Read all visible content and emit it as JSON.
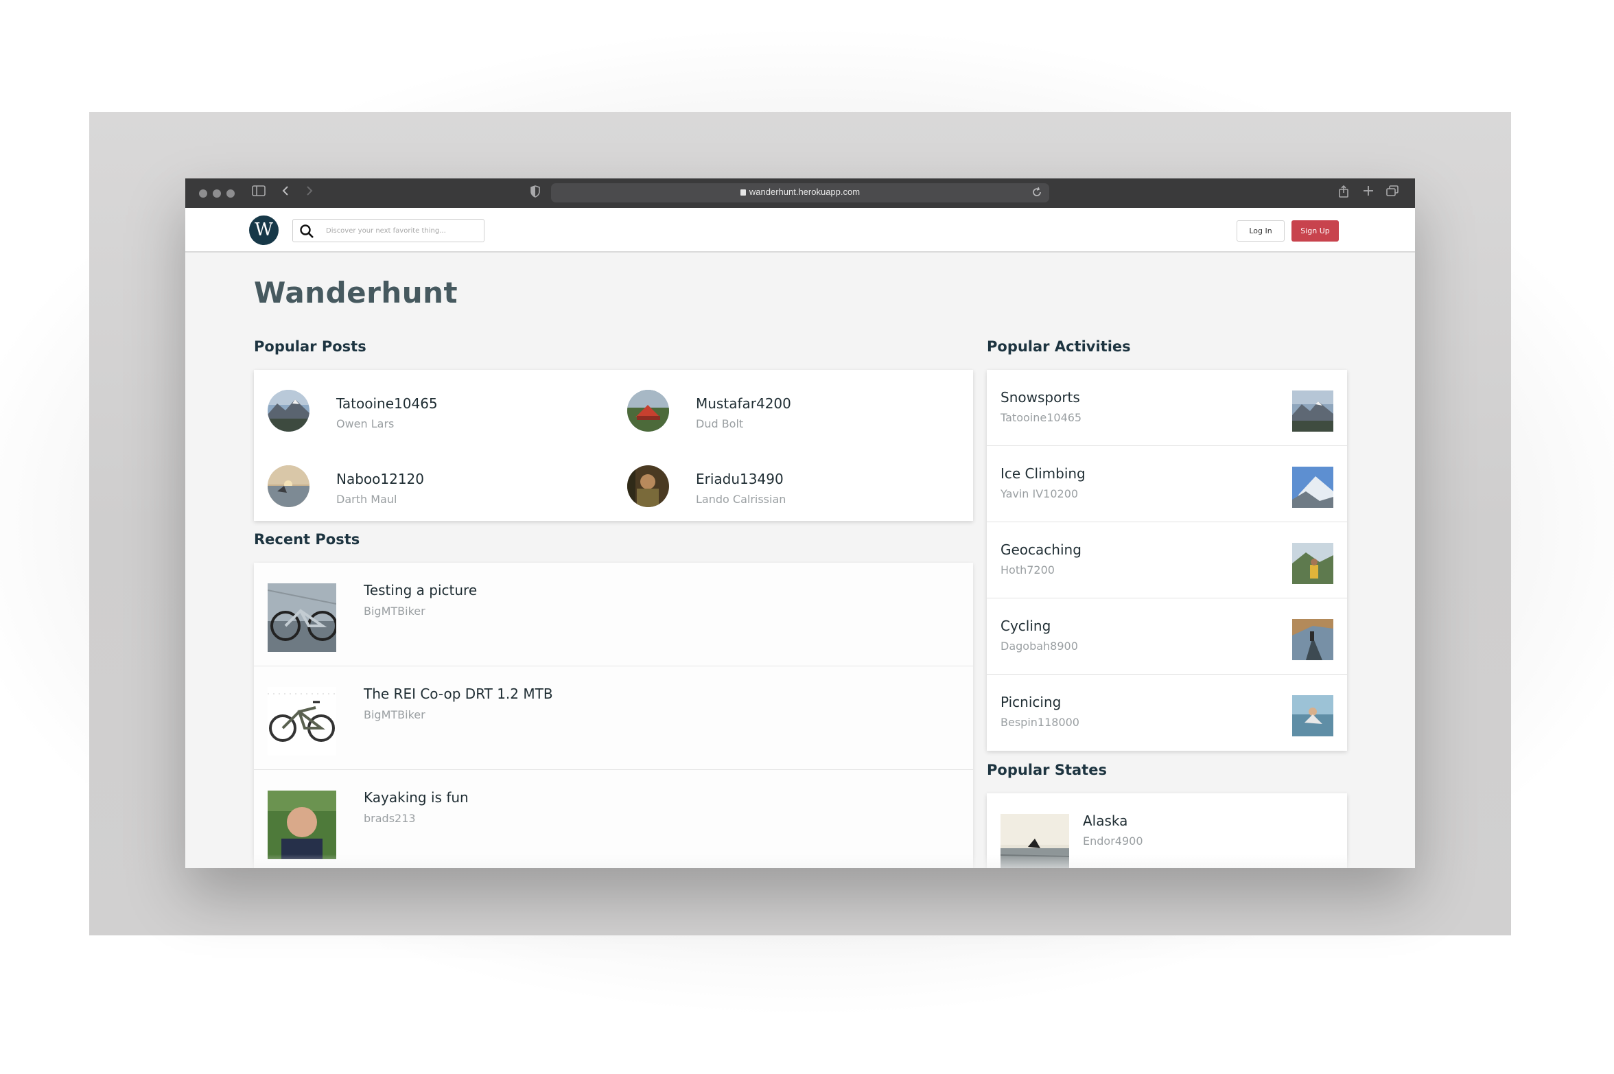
{
  "browser": {
    "url": "wanderhunt.herokuapp.com"
  },
  "navbar": {
    "logo_letter": "W",
    "search_placeholder": "Discover your next favorite thing...",
    "login_label": "Log In",
    "signup_label": "Sign Up",
    "signup_color": "#c8434d",
    "logo_color": "#173848"
  },
  "page": {
    "title": "Wanderhunt"
  },
  "popular_posts": {
    "heading": "Popular Posts",
    "items": [
      {
        "title": "Tatooine10465",
        "author": "Owen Lars"
      },
      {
        "title": "Mustafar4200",
        "author": "Dud Bolt"
      },
      {
        "title": "Naboo12120",
        "author": "Darth Maul"
      },
      {
        "title": "Eriadu13490",
        "author": "Lando Calrissian"
      }
    ]
  },
  "recent_posts": {
    "heading": "Recent Posts",
    "items": [
      {
        "title": "Testing a picture",
        "author": "BigMTBiker"
      },
      {
        "title": "The REI Co-op DRT 1.2 MTB",
        "author": "BigMTBiker"
      },
      {
        "title": "Kayaking is fun",
        "author": "brads213"
      }
    ]
  },
  "popular_activities": {
    "heading": "Popular Activities",
    "items": [
      {
        "title": "Snowsports",
        "location": "Tatooine10465"
      },
      {
        "title": "Ice Climbing",
        "location": "Yavin IV10200"
      },
      {
        "title": "Geocaching",
        "location": "Hoth7200"
      },
      {
        "title": "Cycling",
        "location": "Dagobah8900"
      },
      {
        "title": "Picnicing",
        "location": "Bespin118000"
      }
    ]
  },
  "popular_states": {
    "heading": "Popular States",
    "items": [
      {
        "title": "Alaska",
        "location": "Endor4900"
      }
    ]
  }
}
